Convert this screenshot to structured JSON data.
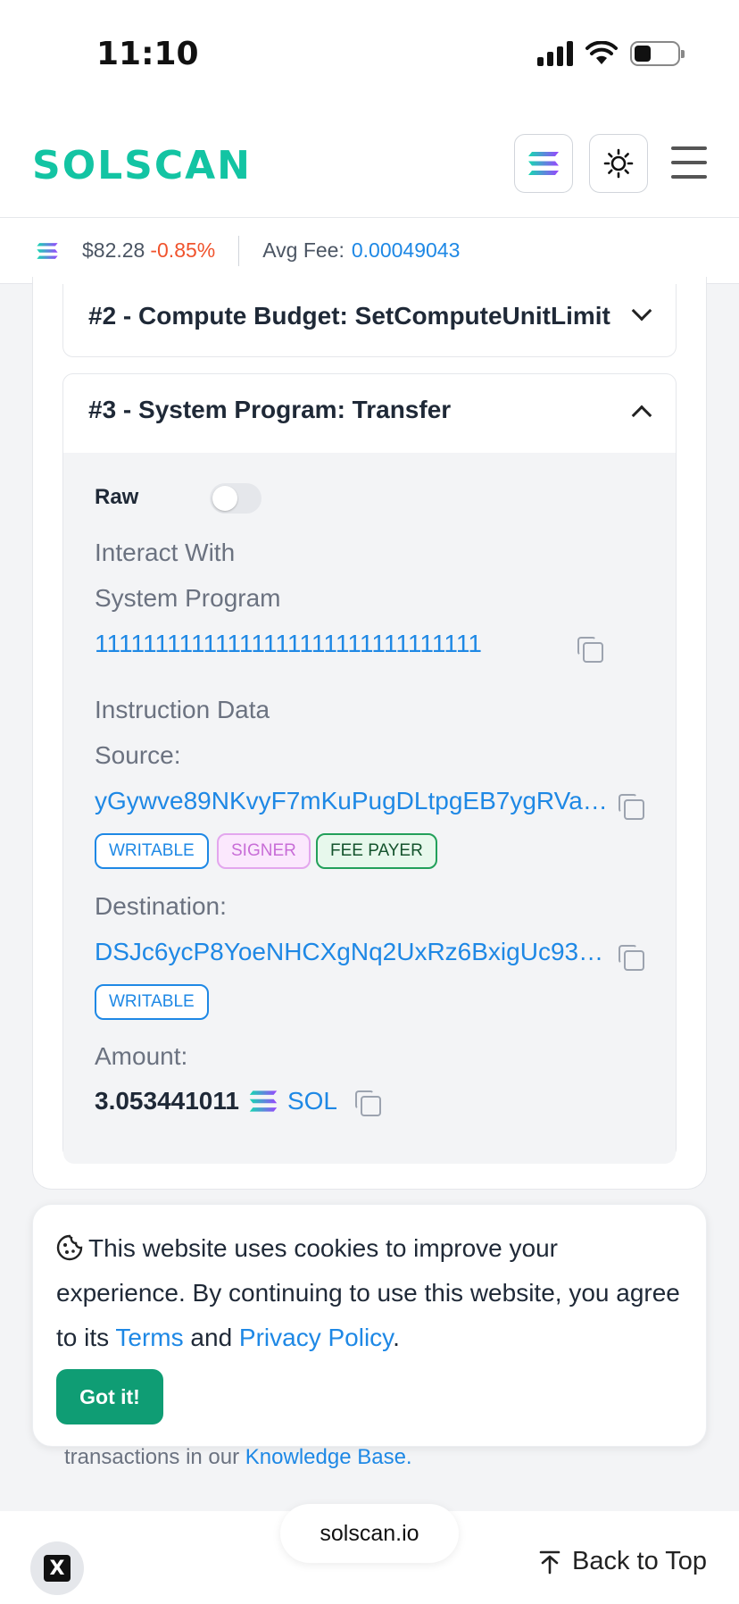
{
  "status_bar": {
    "time": "11:10"
  },
  "header": {
    "logo": "SOLSCAN"
  },
  "price_bar": {
    "price": "$82.28",
    "change": "-0.85%",
    "avg_fee_label": "Avg Fee:",
    "avg_fee_value": "0.00049043"
  },
  "instructions": [
    {
      "title": "#2 - Compute Budget: SetComputeUnitLimit",
      "state": "collapsed"
    },
    {
      "title": "#3 - System Program: Transfer",
      "state": "expanded"
    }
  ],
  "detail": {
    "raw_label": "Raw",
    "interact_with_label": "Interact With",
    "program_name": "System Program",
    "program_address": "11111111111111111111111111111111",
    "instruction_data_label": "Instruction Data",
    "source_label": "Source:",
    "source_address": "yGywve89NKvyF7mKuPugDLtpgEB7ygRVa…",
    "source_tags": [
      "WRITABLE",
      "SIGNER",
      "FEE PAYER"
    ],
    "destination_label": "Destination:",
    "destination_address": "DSJc6ycP8YoeNHCXgNq2UxRz6BxigUc93…",
    "destination_tags": [
      "WRITABLE"
    ],
    "amount_label": "Amount:",
    "amount_value": "3.053441011",
    "amount_token": "SOL"
  },
  "cookie": {
    "text_before": "This website uses cookies to improve your experience. By continuing to use this website, you agree to its ",
    "terms": "Terms",
    "and": " and ",
    "privacy": "Privacy Policy",
    "period": ".",
    "button": "Got it!"
  },
  "footer": {
    "kb_prefix": "transactions in our ",
    "kb_link": "Knowledge Base."
  },
  "bottom_bar": {
    "x_label": "X",
    "url": "solscan.io",
    "back_to_top": "Back to Top"
  },
  "colors": {
    "brand": "#13c4a3",
    "link": "#1e88e5",
    "negative": "#f0532d",
    "button": "#0f9d74"
  },
  "icons": [
    "solana-icon",
    "sun-icon",
    "menu-icon",
    "chevron-down-icon",
    "chevron-up-icon",
    "copy-icon",
    "cookie-icon",
    "x-logo-icon",
    "arrow-up-icon"
  ]
}
